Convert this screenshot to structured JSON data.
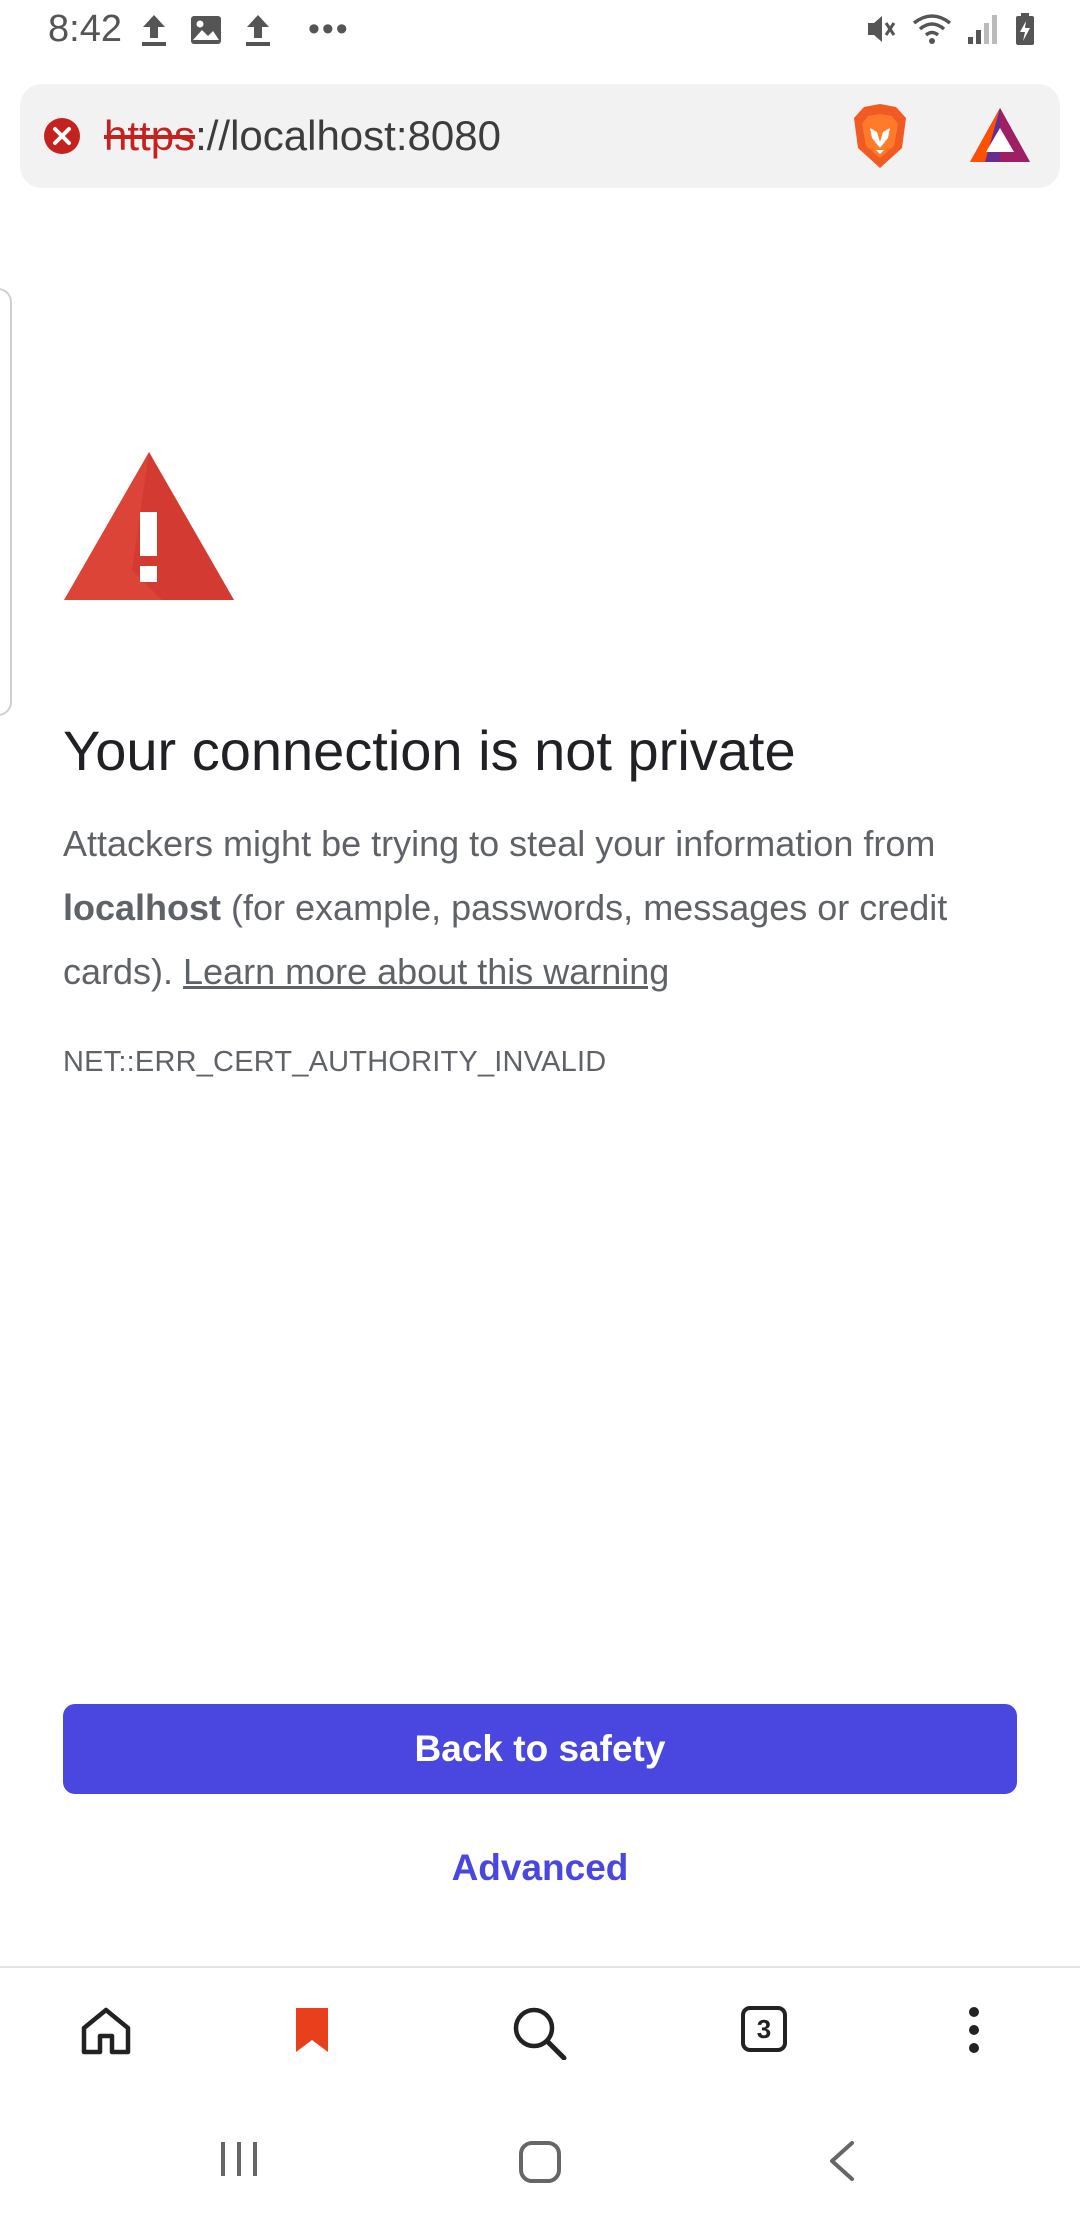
{
  "status_bar": {
    "time": "8:42",
    "left_icons": [
      "upload-icon",
      "image-icon",
      "upload-icon",
      "more-dots-icon"
    ],
    "right_icons": [
      "mute-vibrate-icon",
      "wifi-icon",
      "signal-icon",
      "battery-charging-icon"
    ]
  },
  "url_bar": {
    "scheme": "https",
    "rest": "://localhost:8080",
    "security_icon": "not-secure-error-icon",
    "shield_icon": "brave-shield-icon",
    "rewards_icon": "bat-rewards-icon"
  },
  "interstitial": {
    "title": "Your connection is not private",
    "body_prefix": "Attackers might be trying to steal your information from ",
    "host": "localhost",
    "body_middle": " (for example, passwords, messages or credit cards). ",
    "learn_more": "Learn more about this warning",
    "error_code": "NET::ERR_CERT_AUTHORITY_INVALID",
    "back_button": "Back to safety",
    "advanced_button": "Advanced"
  },
  "toolbar": {
    "tab_count": "3",
    "icons": [
      "home-icon",
      "bookmark-icon",
      "search-icon",
      "tabs-icon",
      "menu-icon"
    ]
  },
  "colors": {
    "accent": "#4a46e0",
    "warning_red": "#db4437",
    "bookmark_orange": "#e8401c"
  },
  "nav_bar": {
    "icons": [
      "recents-icon",
      "home-button-icon",
      "back-icon"
    ]
  }
}
